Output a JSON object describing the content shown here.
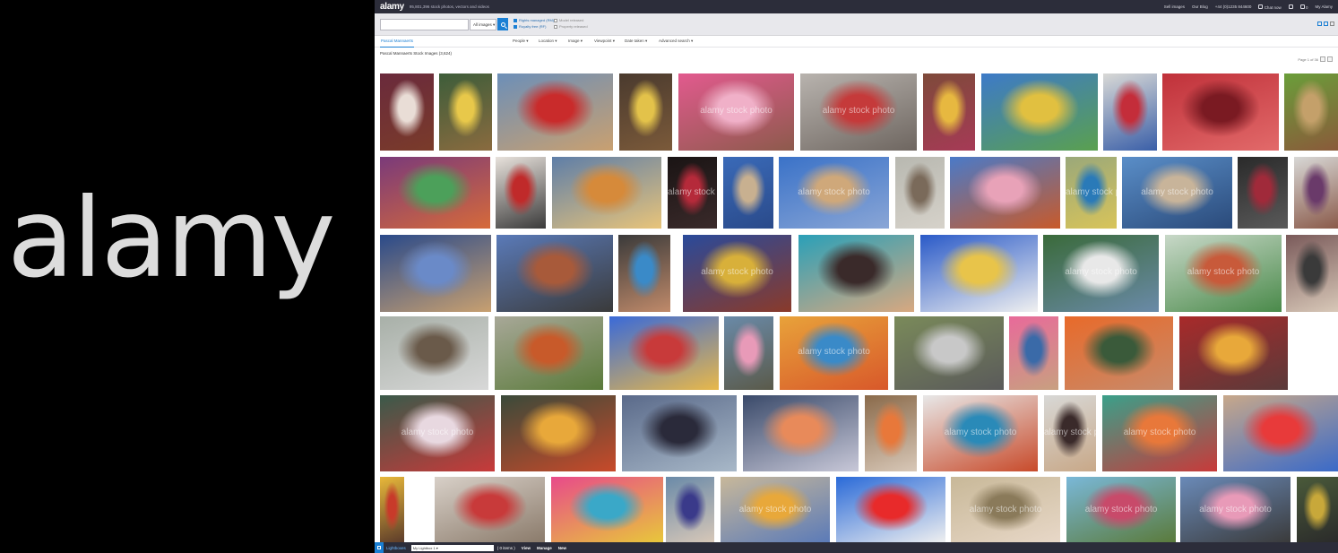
{
  "branding": {
    "big_logo": "alamy"
  },
  "topbar": {
    "logo": "alamy",
    "tagline": "95,801,396 stock photos, vectors and videos",
    "links": [
      "Sell images",
      "Our Blog",
      "+44 (0)1235 844600",
      "Chat now",
      "0",
      "My Alamy"
    ]
  },
  "search": {
    "query": "",
    "type_select": "All images",
    "filters_left": [
      "Rights managed (RM)",
      "Royalty free (RF)"
    ],
    "filters_right": [
      "Model released",
      "Property released"
    ]
  },
  "nav": {
    "active_tab": "Pascal Mannaerts",
    "dropdowns": [
      "People",
      "Location",
      "Image",
      "Viewpoint",
      "Date taken",
      "Advanced search"
    ]
  },
  "results": {
    "count_text": "Pascal Mannaerts Stock Images (3,624)",
    "page_text": "Page 1 of 36"
  },
  "watermark": "alamy stock photo",
  "lightbox": {
    "label": "Lightboxes",
    "select_value": "My Lightbox 1",
    "count": "( 0 items )",
    "actions": [
      "View",
      "Manage",
      "New"
    ]
  },
  "colors": {
    "accent": "#1a7fd4",
    "topbar": "#2c2d3a"
  },
  "thumbnails": [
    {
      "row": 0,
      "colors": [
        "#6a2a3c",
        "#e9ddd6",
        "#7a3b2a"
      ]
    },
    {
      "row": 0,
      "colors": [
        "#3d5d3a",
        "#e8c84a",
        "#8a6b3f"
      ]
    },
    {
      "row": 0,
      "colors": [
        "#6c8fb8",
        "#c92b2b",
        "#c9a070"
      ]
    },
    {
      "row": 0,
      "colors": [
        "#4a3a2e",
        "#e3c24a",
        "#7b5a3a"
      ]
    },
    {
      "row": 0,
      "colors": [
        "#e25a8e",
        "#f0b0c8",
        "#8d5a4c"
      ]
    },
    {
      "row": 0,
      "colors": [
        "#b8b3ae",
        "#c53a3a",
        "#6e6660"
      ]
    },
    {
      "row": 0,
      "colors": [
        "#7e4a3a",
        "#e7b840",
        "#a63a56"
      ]
    },
    {
      "row": 0,
      "colors": [
        "#3d7ac8",
        "#e1c040",
        "#5aa04f"
      ]
    },
    {
      "row": 0,
      "colors": [
        "#d9d9d6",
        "#c42d3a",
        "#3a5fa8"
      ]
    },
    {
      "row": 0,
      "colors": [
        "#c0313a",
        "#7a1a22",
        "#e26a6a"
      ]
    },
    {
      "row": 0,
      "colors": [
        "#6a9e3a",
        "#c4a06a",
        "#8a5a3a"
      ]
    },
    {
      "row": 1,
      "colors": [
        "#7a3a7a",
        "#4ca05a",
        "#d66a3a"
      ]
    },
    {
      "row": 1,
      "colors": [
        "#e8e2dc",
        "#c02a2a",
        "#3a3a3a"
      ]
    },
    {
      "row": 1,
      "colors": [
        "#5e7ea8",
        "#d68a3a",
        "#e8c47a"
      ]
    },
    {
      "row": 1,
      "colors": [
        "#1a1414",
        "#b52a3a",
        "#3a2a2a"
      ]
    },
    {
      "row": 1,
      "colors": [
        "#3a6ab8",
        "#c8b090",
        "#2a4a8a"
      ]
    },
    {
      "row": 1,
      "colors": [
        "#3a72c8",
        "#cfa87a",
        "#8aa6d6"
      ]
    },
    {
      "row": 1,
      "colors": [
        "#b8b8b0",
        "#7a6a5a",
        "#d6d2ca"
      ]
    },
    {
      "row": 1,
      "colors": [
        "#4a7ac8",
        "#e8a2b8",
        "#c85a2a"
      ]
    },
    {
      "row": 1,
      "colors": [
        "#9aa87a",
        "#2a7ab8",
        "#d8c45a"
      ]
    },
    {
      "row": 1,
      "colors": [
        "#5a8ec8",
        "#c8b49a",
        "#2a4a7a"
      ]
    },
    {
      "row": 1,
      "colors": [
        "#2a2a2a",
        "#a02a3a",
        "#5a5a5a"
      ]
    },
    {
      "row": 1,
      "colors": [
        "#d8d8d6",
        "#6a3a6a",
        "#8a5a4a"
      ]
    },
    {
      "row": 2,
      "colors": [
        "#2a4a8a",
        "#6a8ac8",
        "#c8a070"
      ]
    },
    {
      "row": 2,
      "colors": [
        "#5a7ab8",
        "#a85a3a",
        "#3a3a3a"
      ]
    },
    {
      "row": 2,
      "colors": [
        "#3a3a3a",
        "#3a8ac8",
        "#c08a6a"
      ]
    },
    {
      "row": 2,
      "colors": [
        "#2a4a9a",
        "#d8b03a",
        "#8a3a2a"
      ]
    },
    {
      "row": 2,
      "colors": [
        "#2aa0b8",
        "#3a2a2a",
        "#d8a880"
      ]
    },
    {
      "row": 2,
      "colors": [
        "#2a5ac8",
        "#e8c44a",
        "#f0f0f0"
      ]
    },
    {
      "row": 2,
      "colors": [
        "#3a6a3a",
        "#e8e8e8",
        "#6a8aa8"
      ]
    },
    {
      "row": 2,
      "colors": [
        "#c8d8c8",
        "#c85a3a",
        "#4a8a4a"
      ]
    },
    {
      "row": 2,
      "colors": [
        "#7a5a5a",
        "#3a3a3a",
        "#d8c8b8"
      ]
    },
    {
      "row": 3,
      "colors": [
        "#a8b0a8",
        "#6a5a4a",
        "#d8d8d8"
      ]
    },
    {
      "row": 3,
      "colors": [
        "#a8a898",
        "#c85a2a",
        "#5a7a3a"
      ]
    },
    {
      "row": 3,
      "colors": [
        "#3a6ad8",
        "#c83a3a",
        "#e8b84a"
      ]
    },
    {
      "row": 3,
      "colors": [
        "#6a8aa8",
        "#e89ab8",
        "#5a5a4a"
      ]
    },
    {
      "row": 3,
      "colors": [
        "#e8a23a",
        "#3a8ac8",
        "#d8582a"
      ]
    },
    {
      "row": 3,
      "colors": [
        "#7a8a5a",
        "#c8c8c8",
        "#5a5a5a"
      ]
    },
    {
      "row": 3,
      "colors": [
        "#e86a9a",
        "#3a6aa8",
        "#c8a080"
      ]
    },
    {
      "row": 3,
      "colors": [
        "#e86a2a",
        "#3a5a3a",
        "#c88a6a"
      ]
    },
    {
      "row": 3,
      "colors": [
        "#a82a2a",
        "#e8a83a",
        "#5a3a3a"
      ]
    },
    {
      "row": 4,
      "colors": [
        "#3a5a4a",
        "#e8d8e0",
        "#c83a3a"
      ]
    },
    {
      "row": 4,
      "colors": [
        "#3a4a3a",
        "#e8a83a",
        "#c84a2a"
      ]
    },
    {
      "row": 4,
      "colors": [
        "#5a6a8a",
        "#2a2a3a",
        "#a8b8c8"
      ]
    },
    {
      "row": 4,
      "colors": [
        "#3a4a6a",
        "#e88a5a",
        "#c8c8d8"
      ]
    },
    {
      "row": 4,
      "colors": [
        "#8a6a4a",
        "#e8783a",
        "#d8c8b8"
      ]
    },
    {
      "row": 4,
      "colors": [
        "#e8e8e8",
        "#2a8ab8",
        "#c84a2a"
      ]
    },
    {
      "row": 4,
      "colors": [
        "#d8d8d6",
        "#3a2a2a",
        "#c8a888"
      ]
    },
    {
      "row": 4,
      "colors": [
        "#3aa08a",
        "#e8783a",
        "#c83a3a"
      ]
    },
    {
      "row": 4,
      "colors": [
        "#c8a88a",
        "#e83a3a",
        "#3a6ac8"
      ]
    },
    {
      "row": 5,
      "colors": [
        "#e8b83a",
        "#c83a2a",
        "#5a3a2a"
      ]
    },
    {
      "row": 5,
      "colors": [
        "#d8d0c8",
        "#c83a3a",
        "#8a7a6a"
      ]
    },
    {
      "row": 5,
      "colors": [
        "#e84a8a",
        "#3aa8c8",
        "#e8c83a"
      ]
    },
    {
      "row": 5,
      "colors": [
        "#6a8aa8",
        "#3a3a8a",
        "#d8c8b8"
      ]
    },
    {
      "row": 5,
      "colors": [
        "#c8b89a",
        "#e8a83a",
        "#5a7ab8"
      ]
    },
    {
      "row": 5,
      "colors": [
        "#2a6ad8",
        "#e82a2a",
        "#f0f0f0"
      ]
    },
    {
      "row": 5,
      "colors": [
        "#c8b898",
        "#8a7a5a",
        "#e8d8c8"
      ]
    },
    {
      "row": 5,
      "colors": [
        "#7ab8d8",
        "#c84a6a",
        "#5a7a3a"
      ]
    },
    {
      "row": 5,
      "colors": [
        "#6a8ab8",
        "#e89ab8",
        "#3a3a3a"
      ]
    },
    {
      "row": 5,
      "colors": [
        "#4a5a3a",
        "#c8a83a",
        "#2a2a2a"
      ]
    }
  ]
}
